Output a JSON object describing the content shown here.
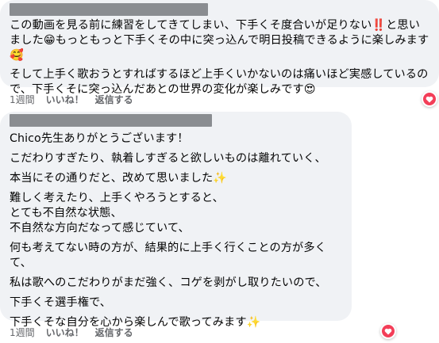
{
  "comment1": {
    "author_redacted": "",
    "paragraphs": [
      "この動画を見る前に練習をしてきてしまい、下手くそ度合いが足りない‼️と思いました😁もっともっと下手くその中に突っ込んで明日投稿できるように楽しみます🥰",
      "そして上手く歌おうとすればするほど上手くいかないのは痛いほど実感しているので、下手くそに突っ込んだあとの世界の変化が楽しみです😍"
    ],
    "time": "1週間",
    "like": "いいね！",
    "reply": "返信する",
    "reaction_icon": "heart-icon"
  },
  "comment2": {
    "author_redacted": "",
    "paragraphs": [
      "Chico先生ありがとうございます！",
      "こだわりすぎたり、執着しすぎると欲しいものは離れていく、",
      "本当にその通りだと、改めて思いました✨",
      "難しく考えたり、上手くやろうとすると、\nとても不自然な状態、\n不自然な方向だなって感じていて、",
      "何も考えてない時の方が、結果的に上手く行くことの方が多くて、",
      "私は歌へのこだわりがまだ強く、コゲを剥がし取りたいので、",
      "下手くそ選手権で、",
      "下手くそな自分を心から楽しんで歌ってみます✨"
    ],
    "time": "1週間",
    "like": "いいね！",
    "reply": "返信する",
    "reaction_icon": "heart-icon"
  },
  "colors": {
    "bubble": "#f0f2f5",
    "meta": "#65676b",
    "heart": "#f33e58"
  }
}
